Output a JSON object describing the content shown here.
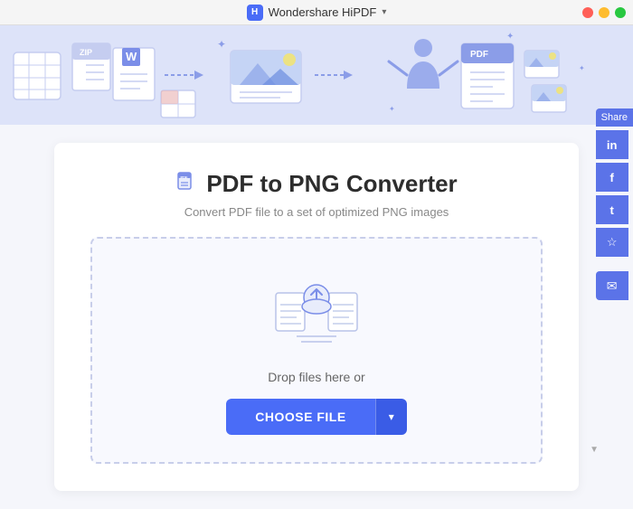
{
  "titleBar": {
    "appName": "Wondershare HiPDF",
    "chevron": "▾"
  },
  "banner": {
    "bgColor": "#dde3f9"
  },
  "converter": {
    "icon": "📄",
    "title": "PDF to PNG Converter",
    "subtitle": "Convert PDF file to a set of optimized PNG images",
    "dropText": "Drop files here or",
    "chooseFileLabel": "CHOOSE FILE",
    "dropdownArrow": "▾"
  },
  "share": {
    "label": "Share",
    "linkedin": "in",
    "facebook": "f",
    "twitter": "t",
    "star": "☆",
    "email": "✉"
  },
  "windowControls": {
    "close": "",
    "min": "",
    "max": ""
  }
}
